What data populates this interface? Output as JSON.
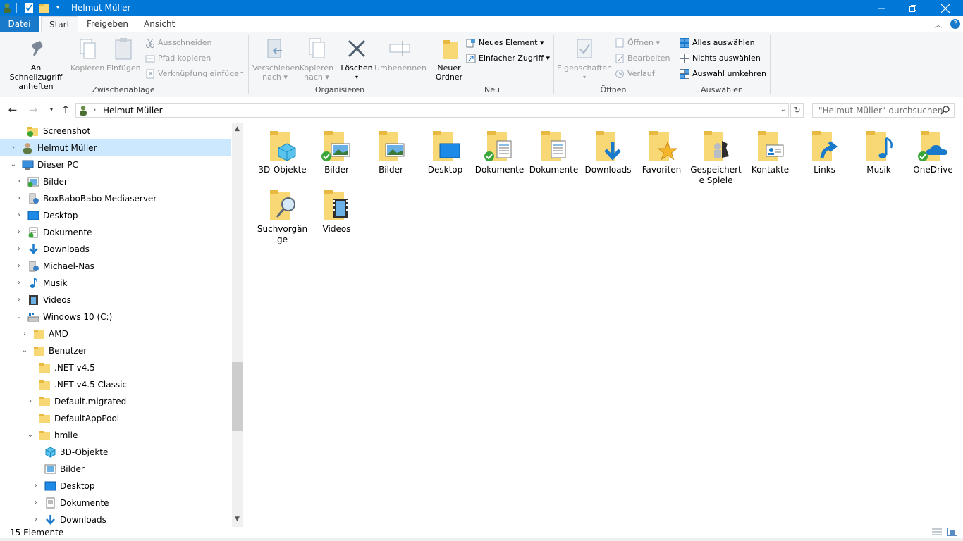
{
  "window": {
    "title": "Helmut Müller"
  },
  "tabs": [
    {
      "label": "Datei"
    },
    {
      "label": "Start"
    },
    {
      "label": "Freigeben"
    },
    {
      "label": "Ansicht"
    }
  ],
  "ribbon": {
    "zwischenablage": {
      "label": "Zwischenablage",
      "pin_line1": "An Schnellzugriff",
      "pin_line2": "anheften",
      "copy": "Kopieren",
      "paste": "Einfügen",
      "cut": "Ausschneiden",
      "copy_path": "Pfad kopieren",
      "paste_link": "Verknüpfung einfügen"
    },
    "organisieren": {
      "label": "Organisieren",
      "move_line1": "Verschieben",
      "move_line2": "nach",
      "copyto_line1": "Kopieren",
      "copyto_line2": "nach",
      "delete": "Löschen",
      "rename": "Umbenennen"
    },
    "neu": {
      "label": "Neu",
      "new_folder_line1": "Neuer",
      "new_folder_line2": "Ordner",
      "new_item": "Neues Element",
      "easy_access": "Einfacher Zugriff"
    },
    "oeffnen": {
      "label": "Öffnen",
      "properties": "Eigenschaften",
      "open": "Öffnen",
      "edit": "Bearbeiten",
      "history": "Verlauf"
    },
    "auswaehlen": {
      "label": "Auswählen",
      "select_all": "Alles auswählen",
      "select_none": "Nichts auswählen",
      "invert": "Auswahl umkehren"
    }
  },
  "address": {
    "path": "Helmut Müller",
    "search_placeholder": "\"Helmut Müller\" durchsuchen"
  },
  "tree": [
    {
      "label": "Screenshot"
    },
    {
      "label": "Helmut Müller"
    },
    {
      "label": "Dieser PC"
    },
    {
      "label": "Bilder"
    },
    {
      "label": "BoxBaboBabo Mediaserver"
    },
    {
      "label": "Desktop"
    },
    {
      "label": "Dokumente"
    },
    {
      "label": "Downloads"
    },
    {
      "label": "Michael-Nas"
    },
    {
      "label": "Musik"
    },
    {
      "label": "Videos"
    },
    {
      "label": "Windows 10 (C:)"
    },
    {
      "label": "AMD"
    },
    {
      "label": "Benutzer"
    },
    {
      "label": ".NET v4.5"
    },
    {
      "label": ".NET v4.5 Classic"
    },
    {
      "label": "Default.migrated"
    },
    {
      "label": "DefaultAppPool"
    },
    {
      "label": "hmlle"
    },
    {
      "label": "3D-Objekte"
    },
    {
      "label": "Bilder"
    },
    {
      "label": "Desktop"
    },
    {
      "label": "Dokumente"
    },
    {
      "label": "Downloads"
    }
  ],
  "items": [
    {
      "name": "3D-Objekte"
    },
    {
      "name": "Bilder"
    },
    {
      "name": "Bilder"
    },
    {
      "name": "Desktop"
    },
    {
      "name": "Dokumente"
    },
    {
      "name": "Dokumente"
    },
    {
      "name": "Downloads"
    },
    {
      "name": "Favoriten"
    },
    {
      "name": "Gespeicherte Spiele"
    },
    {
      "name": "Kontakte"
    },
    {
      "name": "Links"
    },
    {
      "name": "Musik"
    },
    {
      "name": "OneDrive"
    },
    {
      "name": "Suchvorgänge"
    },
    {
      "name": "Videos"
    }
  ],
  "status": {
    "count": "15 Elemente"
  },
  "colors": {
    "accent": "#0078d7",
    "folder": "#f8d775",
    "selection": "#cce8ff"
  }
}
